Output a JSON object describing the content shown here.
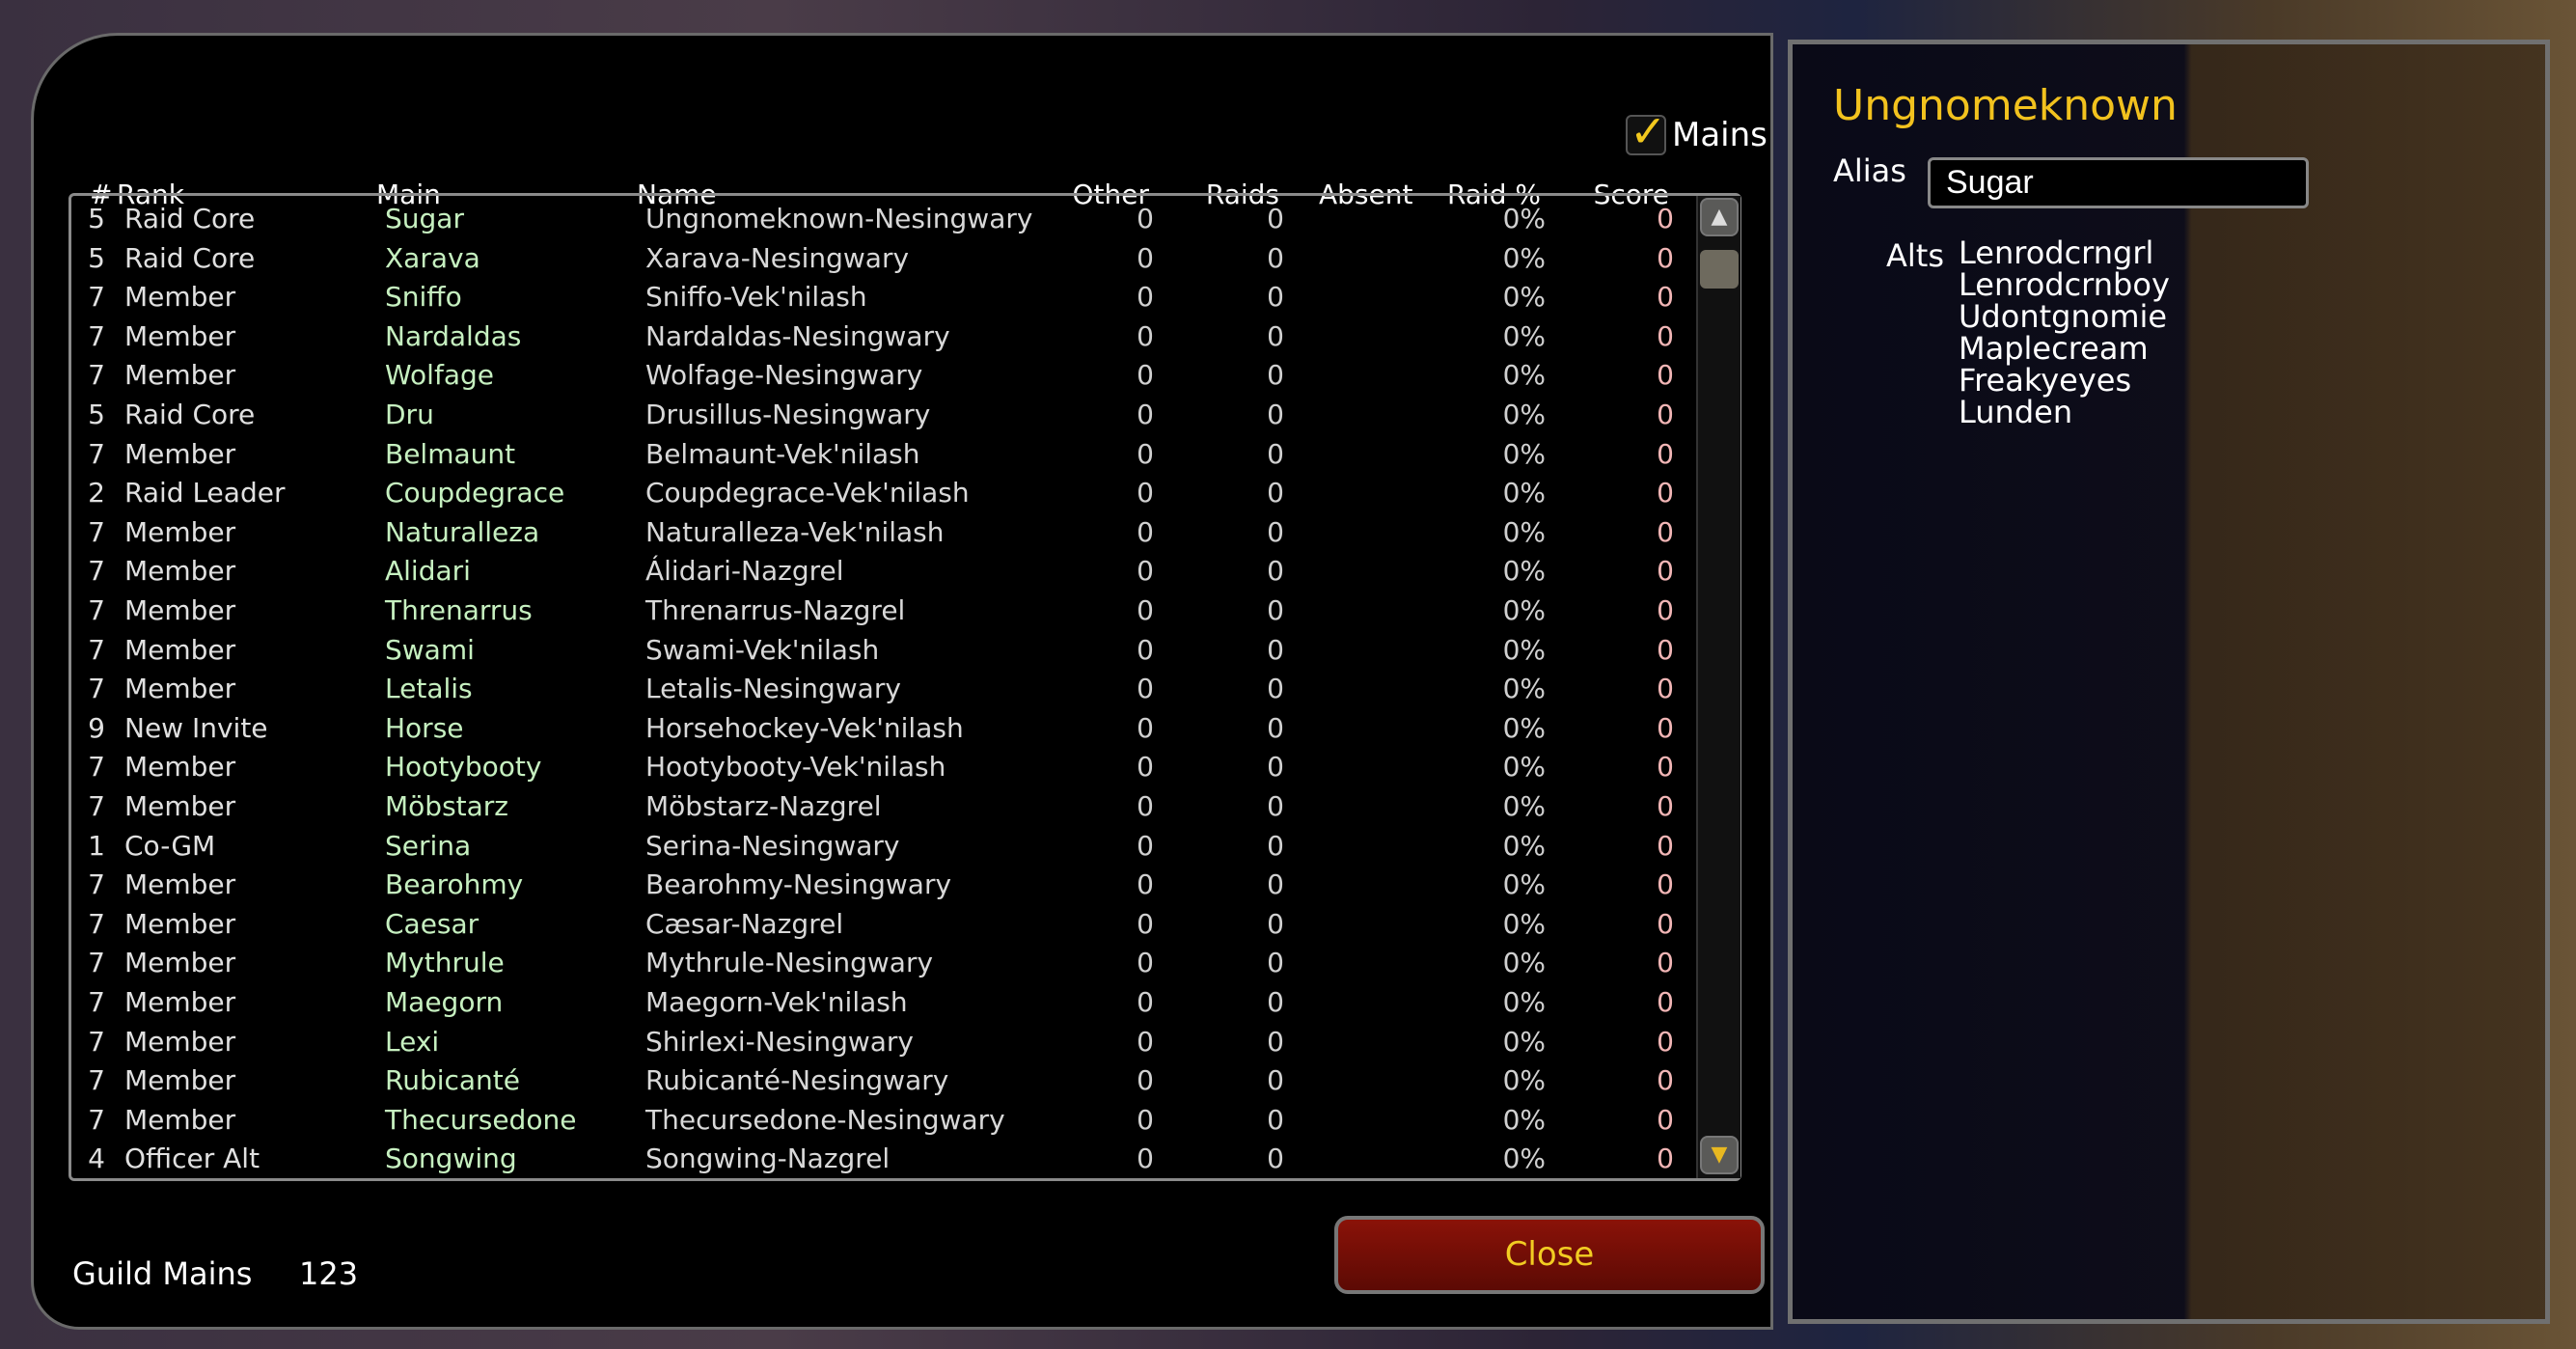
{
  "mains_toggle": {
    "label": "Mains",
    "checked": true
  },
  "columns": [
    "#",
    "Rank",
    "Main",
    "Name",
    "Other",
    "Raids",
    "Absent",
    "Raid %",
    "Score"
  ],
  "rows": [
    [
      "5",
      "Raid Core",
      "Sugar",
      "Ungnomeknown-Nesingwary",
      "0",
      "0",
      "",
      "0%",
      "0"
    ],
    [
      "5",
      "Raid Core",
      "Xarava",
      "Xarava-Nesingwary",
      "0",
      "0",
      "",
      "0%",
      "0"
    ],
    [
      "7",
      "Member",
      "Sniffo",
      "Sniffo-Vek'nilash",
      "0",
      "0",
      "",
      "0%",
      "0"
    ],
    [
      "7",
      "Member",
      "Nardaldas",
      "Nardaldas-Nesingwary",
      "0",
      "0",
      "",
      "0%",
      "0"
    ],
    [
      "7",
      "Member",
      "Wolfage",
      "Wolfage-Nesingwary",
      "0",
      "0",
      "",
      "0%",
      "0"
    ],
    [
      "5",
      "Raid Core",
      "Dru",
      "Drusillus-Nesingwary",
      "0",
      "0",
      "",
      "0%",
      "0"
    ],
    [
      "7",
      "Member",
      "Belmaunt",
      "Belmaunt-Vek'nilash",
      "0",
      "0",
      "",
      "0%",
      "0"
    ],
    [
      "2",
      "Raid Leader",
      "Coupdegrace",
      "Coupdegrace-Vek'nilash",
      "0",
      "0",
      "",
      "0%",
      "0"
    ],
    [
      "7",
      "Member",
      "Naturalleza",
      "Naturalleza-Vek'nilash",
      "0",
      "0",
      "",
      "0%",
      "0"
    ],
    [
      "7",
      "Member",
      "Alidari",
      "Álidari-Nazgrel",
      "0",
      "0",
      "",
      "0%",
      "0"
    ],
    [
      "7",
      "Member",
      "Threnarrus",
      "Threnarrus-Nazgrel",
      "0",
      "0",
      "",
      "0%",
      "0"
    ],
    [
      "7",
      "Member",
      "Swami",
      "Swami-Vek'nilash",
      "0",
      "0",
      "",
      "0%",
      "0"
    ],
    [
      "7",
      "Member",
      "Letalis",
      "Letalis-Nesingwary",
      "0",
      "0",
      "",
      "0%",
      "0"
    ],
    [
      "9",
      "New Invite",
      "Horse",
      "Horsehockey-Vek'nilash",
      "0",
      "0",
      "",
      "0%",
      "0"
    ],
    [
      "7",
      "Member",
      "Hootybooty",
      "Hootybooty-Vek'nilash",
      "0",
      "0",
      "",
      "0%",
      "0"
    ],
    [
      "7",
      "Member",
      "Möbstarz",
      "Möbstarz-Nazgrel",
      "0",
      "0",
      "",
      "0%",
      "0"
    ],
    [
      "1",
      "Co-GM",
      "Serina",
      "Serina-Nesingwary",
      "0",
      "0",
      "",
      "0%",
      "0"
    ],
    [
      "7",
      "Member",
      "Bearohmy",
      "Bearohmy-Nesingwary",
      "0",
      "0",
      "",
      "0%",
      "0"
    ],
    [
      "7",
      "Member",
      "Caesar",
      "Cæsar-Nazgrel",
      "0",
      "0",
      "",
      "0%",
      "0"
    ],
    [
      "7",
      "Member",
      "Mythrule",
      "Mythrule-Nesingwary",
      "0",
      "0",
      "",
      "0%",
      "0"
    ],
    [
      "7",
      "Member",
      "Maegorn",
      "Maegorn-Vek'nilash",
      "0",
      "0",
      "",
      "0%",
      "0"
    ],
    [
      "7",
      "Member",
      "Lexi",
      "Shirlexi-Nesingwary",
      "0",
      "0",
      "",
      "0%",
      "0"
    ],
    [
      "7",
      "Member",
      "Rubicanté",
      "Rubicanté-Nesingwary",
      "0",
      "0",
      "",
      "0%",
      "0"
    ],
    [
      "7",
      "Member",
      "Thecursedone",
      "Thecursedone-Nesingwary",
      "0",
      "0",
      "",
      "0%",
      "0"
    ],
    [
      "4",
      "Officer Alt",
      "Songwing",
      "Songwing-Nazgrel",
      "0",
      "0",
      "",
      "0%",
      "0"
    ]
  ],
  "footer": {
    "label": "Guild Mains",
    "count": "123"
  },
  "close_label": "Close",
  "detail": {
    "title": "Ungnomeknown",
    "alias_label": "Alias",
    "alias_value": "Sugar",
    "alts_label": "Alts",
    "alts": [
      "Lenrodcrngrl",
      "Lenrodcrnboy",
      "Udontgnomie",
      "Maplecream",
      "Freakyeyes",
      "Lunden"
    ]
  },
  "colors": {
    "accent_gold": "#f2c21e",
    "main_name": "#c6f0c0",
    "score": "#f2b6b6",
    "close_button": "#7a1006"
  },
  "icons": {
    "checkbox": "checkmark-icon",
    "scroll_up": "scroll-up-arrow-icon",
    "scroll_down": "scroll-down-arrow-icon"
  }
}
